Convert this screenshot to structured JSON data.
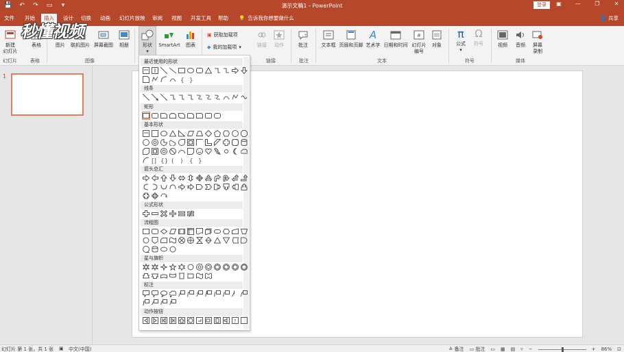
{
  "window": {
    "title": "演示文稿1 - PowerPoint",
    "login_label": "登录",
    "share_label": "共享"
  },
  "tabs": [
    "文件",
    "开始",
    "插入",
    "设计",
    "切换",
    "动画",
    "幻灯片放映",
    "审阅",
    "视图",
    "开发工具",
    "帮助"
  ],
  "active_tab": "插入",
  "tellme": "告诉我你想要做什么",
  "watermark": "秒懂视频",
  "ribbon": {
    "new_slide": "新建\n幻灯片",
    "table": "表格",
    "picture": "图片",
    "online_picture": "联机图片",
    "screenshot": "屏幕截图",
    "album": "相册",
    "shapes": "形状",
    "smartart": "SmartArt",
    "chart": "图表",
    "get_addins": "获取加载项",
    "my_addins": "我的加载项",
    "link": "链接",
    "action": "动作",
    "comment": "批注",
    "textbox": "文本框",
    "header_footer": "页眉和页脚",
    "wordart": "艺术字",
    "datetime": "日期和时间",
    "slide_number": "幻灯片\n编号",
    "object": "对象",
    "equation": "公式",
    "symbol": "符号",
    "video": "视频",
    "audio": "音频",
    "screen_record": "屏幕\n录制",
    "groups": {
      "slides": "幻灯片",
      "tables": "表格",
      "images": "图像",
      "links": "链接",
      "comments": "批注",
      "text": "文本",
      "symbols": "符号",
      "media": "媒体"
    }
  },
  "shapes_gallery": {
    "sections": [
      "最近使用的形状",
      "线条",
      "矩形",
      "基本形状",
      "箭头总汇",
      "公式形状",
      "流程图",
      "星与旗帜",
      "标注",
      "动作按钮"
    ]
  },
  "thumbnails": [
    {
      "number": "1"
    }
  ],
  "statusbar": {
    "slide_info": "幻灯片 第 1 张，共 1 张",
    "language": "中文(中国)",
    "notes": "备注",
    "comments": "批注",
    "zoom": "86%"
  },
  "colors": {
    "accent": "#b7472a",
    "thumb_border": "#e0805f"
  }
}
